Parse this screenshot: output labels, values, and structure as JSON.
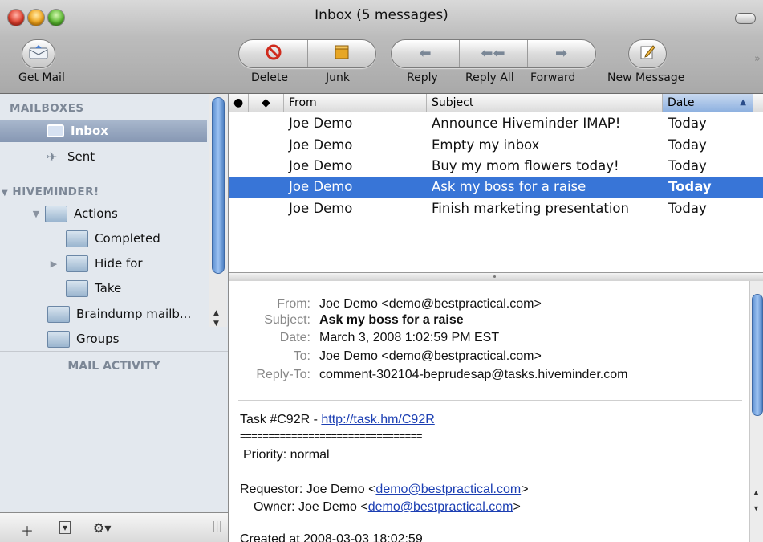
{
  "window": {
    "title": "Inbox (5 messages)"
  },
  "toolbar": {
    "get_mail": "Get Mail",
    "delete": "Delete",
    "junk": "Junk",
    "reply": "Reply",
    "reply_all": "Reply All",
    "forward": "Forward",
    "new_message": "New Message"
  },
  "sidebar": {
    "mailboxes_header": "MAILBOXES",
    "inbox": "Inbox",
    "sent": "Sent",
    "account_header": "HIVEMINDER!",
    "actions": "Actions",
    "completed": "Completed",
    "hide_for": "Hide for",
    "take": "Take",
    "braindump": "Braindump mailb...",
    "groups": "Groups",
    "activity": "MAIL ACTIVITY"
  },
  "list": {
    "columns": {
      "from": "From",
      "subject": "Subject",
      "date": "Date"
    },
    "rows": [
      {
        "from": "Joe Demo",
        "subject": "Announce Hiveminder IMAP!",
        "date": "Today"
      },
      {
        "from": "Joe Demo",
        "subject": "Empty my inbox",
        "date": "Today"
      },
      {
        "from": "Joe Demo",
        "subject": "Buy my mom flowers today!",
        "date": "Today"
      },
      {
        "from": "Joe Demo",
        "subject": "Ask my boss for a raise",
        "date": "Today"
      },
      {
        "from": "Joe Demo",
        "subject": "Finish marketing presentation",
        "date": "Today"
      }
    ]
  },
  "message": {
    "labels": {
      "from": "From:",
      "subject": "Subject:",
      "date": "Date:",
      "to": "To:",
      "reply_to": "Reply-To:"
    },
    "from": "Joe Demo <demo@bestpractical.com>",
    "subject": "Ask my boss for a raise",
    "date": "March 3, 2008 1:02:59 PM EST",
    "to": "Joe Demo <demo@bestpractical.com>",
    "reply_to": "comment-302104-beprudesap@tasks.hiveminder.com",
    "task_prefix": "Task #C92R - ",
    "task_link": "http://task.hm/C92R",
    "rule": "================================",
    "priority": "Priority: normal",
    "requestor_prefix": "Requestor: Joe Demo <",
    "requestor_email": "demo@bestpractical.com",
    "owner_prefix": "Owner: Joe Demo <",
    "owner_email": "demo@bestpractical.com",
    "close": ">",
    "created": "Created at 2008-03-03 18:02:59"
  }
}
